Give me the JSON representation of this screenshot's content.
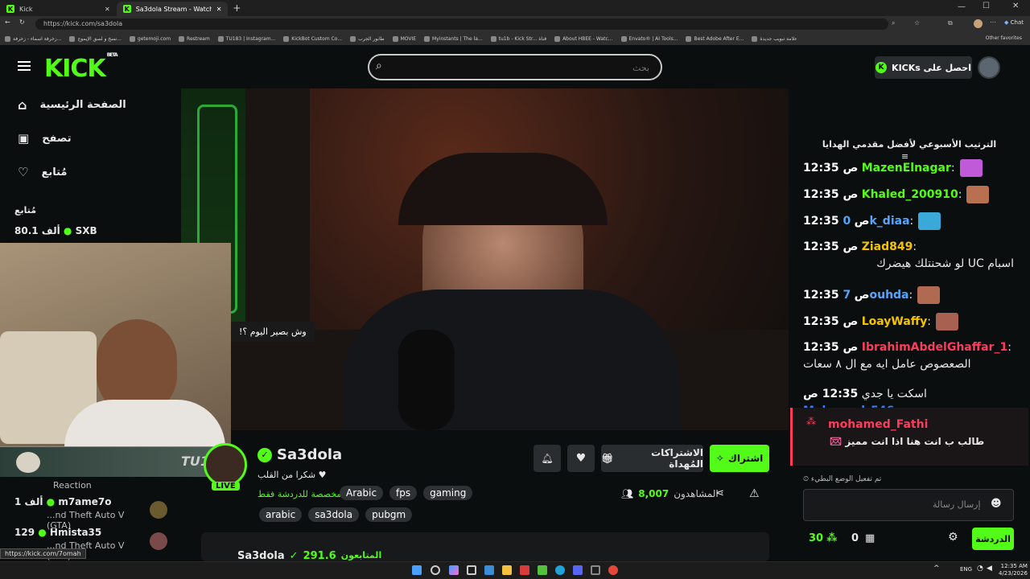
{
  "browser": {
    "tabs": [
      {
        "label": "Kick"
      },
      {
        "label": "Sa3dola Stream - Watch Live..."
      }
    ],
    "url": "https://kick.com/sa3dola",
    "bookmarks": [
      "زخرفة اسماء - زخرفة...",
      "نسخ و لصق الإيموج...",
      "getemoji.com",
      "Restream",
      "TU183 | Instagram...",
      "KickBot Custom Co...",
      "طابور الجرب",
      "MOVIE",
      "Myinstants | The la...",
      "tu1b - Kick Str... قناة",
      "About HBEE - Watc...",
      "Envato® | AI Tools...",
      "Best Adobe After E...",
      "علامة تبويب جديدة"
    ],
    "other_favorites": "Other favorites",
    "chat_btn": "Chat",
    "status_link": "https://kick.com/7omah"
  },
  "header": {
    "logo": "KICK",
    "logo_badge": "BETA",
    "search_placeholder": "بحث",
    "get_kicks": "احصل على KICKs"
  },
  "sidebar": {
    "nav": [
      {
        "label": "الصفحة الرئيسية",
        "icon": "home-icon"
      },
      {
        "label": "تصفح",
        "icon": "browse-icon"
      },
      {
        "label": "مُتابع",
        "icon": "heart-icon"
      }
    ],
    "following_title": "مُتابع",
    "following": [
      {
        "name": "SXB",
        "viewers": "80.1 ألف"
      },
      {
        "name": "m7ame7o",
        "viewers": "1 ألف",
        "category": "...nd Theft Auto V (GTA)"
      },
      {
        "name": "Hmista35",
        "viewers": "129",
        "category": "...nd Theft Auto V (GTA)"
      }
    ],
    "reaction_label": "Reaction"
  },
  "video": {
    "overlay_text": "وش بصير اليوم ؟!",
    "cam_banner": "TU1B"
  },
  "channel": {
    "name": "Sa3dola",
    "bio": "شكرا من القلب",
    "live_badge": "LIVE",
    "language_note": "مخصصة للدردشة فقط",
    "tags_row1": [
      "Arabic",
      "fps",
      "gaming"
    ],
    "tags_row2": [
      "arabic",
      "sa3dola",
      "pubgm"
    ],
    "subscribe": "اشتراك",
    "gift_subs": "الاشتراكات المُهداة",
    "viewers_label": "المشاهدون",
    "viewers": "8,007",
    "about_name": "Sa3dola",
    "about_followers_label": "المتابعون",
    "about_followers": "291.6"
  },
  "chat": {
    "leaderboard_title": "الترتيب الأسبوعي لأفضل مقدمي الهدايا",
    "messages": [
      {
        "time": "12:35 ص",
        "user": "MazenElnagar",
        "color": "#53fc18",
        "text": ""
      },
      {
        "time": "12:35 ص",
        "user": "Khaled_200910",
        "color": "#53fc18",
        "text": ""
      },
      {
        "time": "12:35 ص",
        "user": "0k_diaa",
        "color": "#53a6fc",
        "text": ""
      },
      {
        "time": "12:35 ص",
        "user": "Ziad849",
        "color": "#f5c300",
        "text": "اسبام UC لو شحنتلك هيضرك"
      },
      {
        "time": "12:35 ص",
        "user": "7ouhda",
        "color": "#53a6fc",
        "text": ""
      },
      {
        "time": "12:35 ص",
        "user": "LoayWaffy",
        "color": "#f5c300",
        "text": ""
      },
      {
        "time": "12:35 ص",
        "user": "IbrahimAbdelGhaffar_1",
        "color": "#ff3b5c",
        "text": "الصعصوص عامل ايه مع ال ٨ سعات"
      },
      {
        "time": "12:35 ص",
        "user": "Mohamed_546",
        "color": "#3b7bff",
        "text": "اسكت يا جدي"
      }
    ],
    "pinned_user": "mohamed_Fathi",
    "pinned_text": "طالب ب انت هنا اذا انت مميز",
    "slow_mode": "تم تفعيل الوضع البطيء",
    "input_placeholder": "إرسال رسالة",
    "points": "30",
    "gifts": "0",
    "send_btn": "الدردشة"
  },
  "taskbar": {
    "lang": "ENG",
    "time": "12:35 AM",
    "date": "4/23/2026"
  }
}
